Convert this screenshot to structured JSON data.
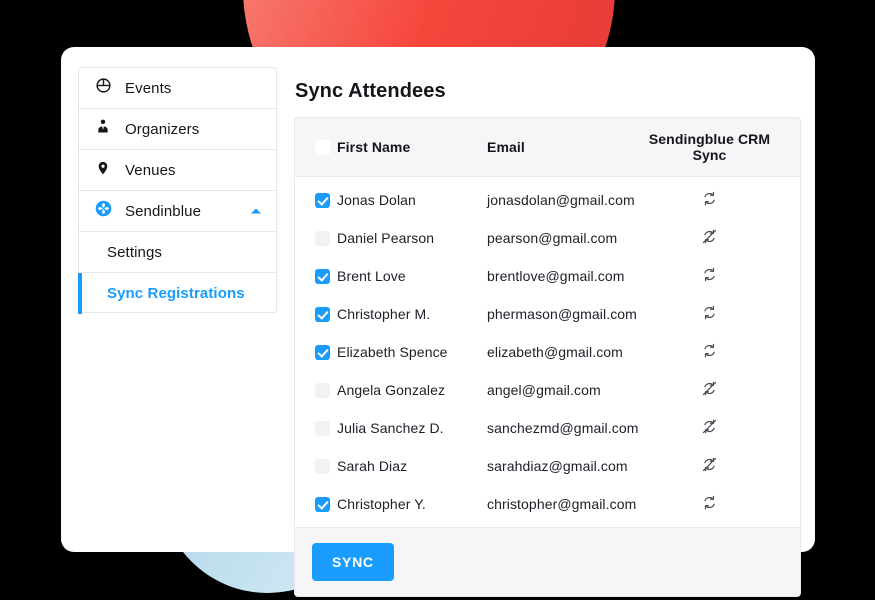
{
  "background": {
    "canvas_color": "#000000",
    "blob_red_color": "#f6463c",
    "blob_blue_color": "#bfdff0"
  },
  "theme": {
    "accent": "#1a9cfc",
    "text": "#15161a",
    "panel_header_bg": "#f6f6f8",
    "border": "#e6e7ea"
  },
  "sidebar": {
    "items": [
      {
        "label": "Events",
        "icon": "event-ticket-icon",
        "type": "top",
        "active": false,
        "expanded": null
      },
      {
        "label": "Organizers",
        "icon": "organizer-icon",
        "type": "top",
        "active": false,
        "expanded": null
      },
      {
        "label": "Venues",
        "icon": "map-pin-icon",
        "type": "top",
        "active": false,
        "expanded": null
      },
      {
        "label": "Sendinblue",
        "icon": "sendinblue-icon",
        "type": "top",
        "active": false,
        "expanded": true
      },
      {
        "label": "Settings",
        "icon": "",
        "type": "sub",
        "active": false,
        "expanded": null
      },
      {
        "label": "Sync Registrations",
        "icon": "",
        "type": "sub",
        "active": true,
        "expanded": null
      }
    ]
  },
  "main": {
    "page_title": "Sync Attendees",
    "table": {
      "columns": [
        "",
        "First Name",
        "Email",
        "Sendingblue CRM Sync"
      ],
      "header_checkbox_checked": false,
      "rows": [
        {
          "checked": true,
          "first_name": "Jonas Dolan",
          "email": "jonasdolan@gmail.com",
          "sync_icon": "sync-icon"
        },
        {
          "checked": false,
          "first_name": "Daniel Pearson",
          "email": "pearson@gmail.com",
          "sync_icon": "sync-off-icon"
        },
        {
          "checked": true,
          "first_name": "Brent Love",
          "email": "brentlove@gmail.com",
          "sync_icon": "sync-icon"
        },
        {
          "checked": true,
          "first_name": "Christopher M.",
          "email": "phermason@gmail.com",
          "sync_icon": "sync-icon"
        },
        {
          "checked": true,
          "first_name": "Elizabeth Spence",
          "email": "elizabeth@gmail.com",
          "sync_icon": "sync-icon"
        },
        {
          "checked": false,
          "first_name": "Angela Gonzalez",
          "email": "angel@gmail.com",
          "sync_icon": "sync-off-icon"
        },
        {
          "checked": false,
          "first_name": "Julia Sanchez D.",
          "email": "sanchezmd@gmail.com",
          "sync_icon": "sync-off-icon"
        },
        {
          "checked": false,
          "first_name": "Sarah Diaz",
          "email": "sarahdiaz@gmail.com",
          "sync_icon": "sync-off-icon"
        },
        {
          "checked": true,
          "first_name": "Christopher Y.",
          "email": "christopher@gmail.com",
          "sync_icon": "sync-icon"
        }
      ]
    },
    "footer": {
      "sync_button_label": "SYNC"
    }
  }
}
